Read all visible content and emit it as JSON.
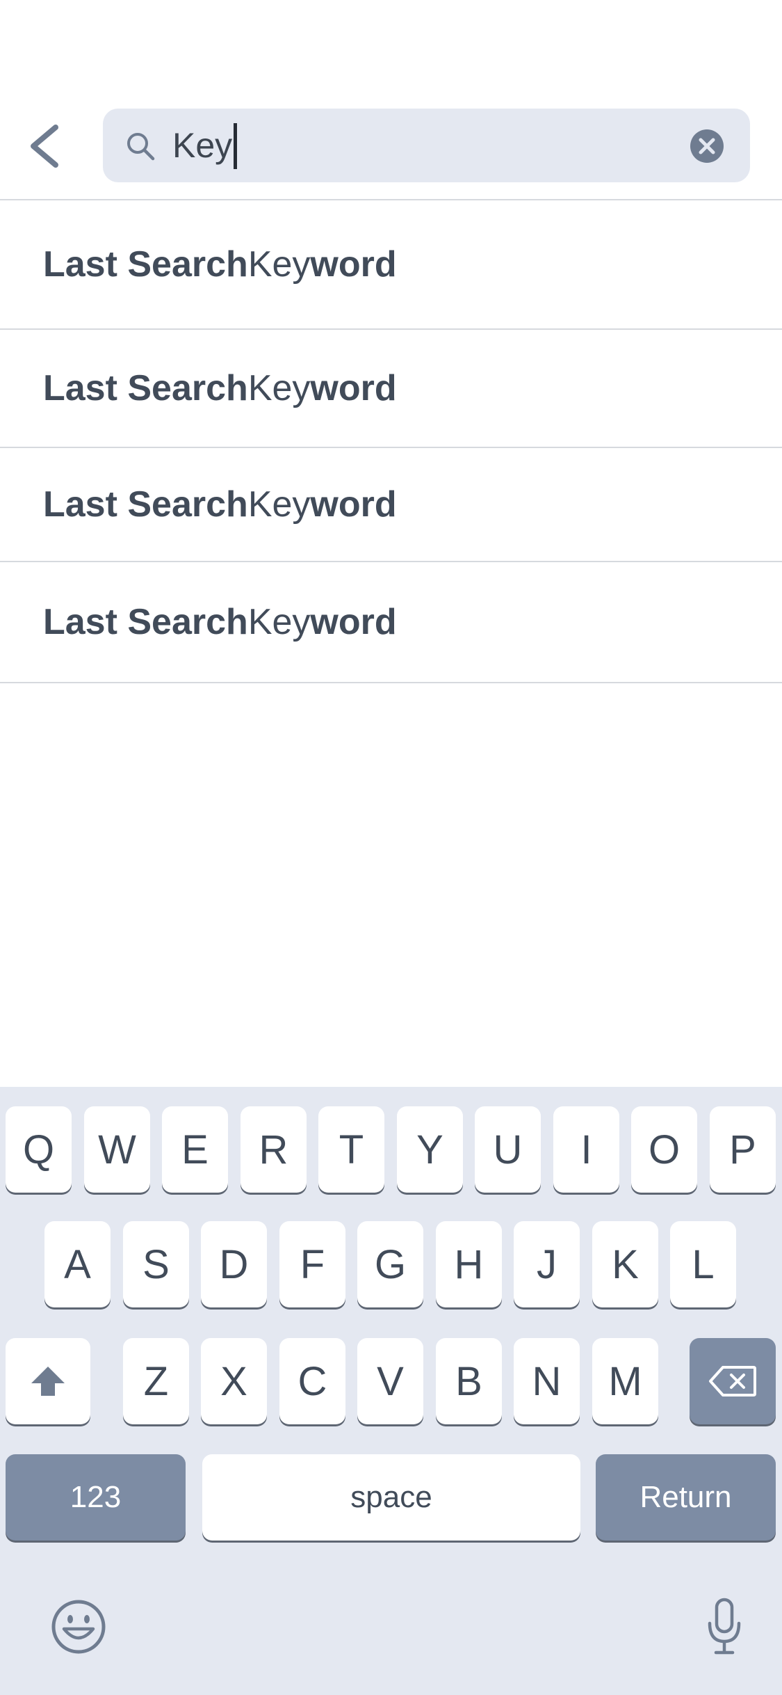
{
  "search": {
    "value": "Key"
  },
  "suggestions": [
    {
      "prefix": "Last Search",
      "match": "Key",
      "suffix": "word"
    },
    {
      "prefix": "Last Search",
      "match": "Key",
      "suffix": "word"
    },
    {
      "prefix": "Last Search",
      "match": "Key",
      "suffix": "word"
    },
    {
      "prefix": "Last Search",
      "match": "Key",
      "suffix": "word"
    }
  ],
  "keyboard": {
    "row1": [
      "Q",
      "W",
      "E",
      "R",
      "T",
      "Y",
      "U",
      "I",
      "O",
      "P"
    ],
    "row2": [
      "A",
      "S",
      "D",
      "F",
      "G",
      "H",
      "J",
      "K",
      "L"
    ],
    "row3": [
      "Z",
      "X",
      "C",
      "V",
      "B",
      "N",
      "M"
    ],
    "numbers_label": "123",
    "space_label": "space",
    "return_label": "Return"
  },
  "icons": {
    "back": "chevron-left-icon",
    "search": "search-icon",
    "clear": "clear-circle-icon",
    "shift": "shift-icon",
    "backspace": "backspace-icon",
    "emoji": "emoji-icon",
    "mic": "microphone-icon"
  },
  "colors": {
    "text": "#414b59",
    "search_bg": "#e4e8f1",
    "keyboard_bg": "#e4e8f1",
    "dark_key": "#7d8ca4",
    "icon": "#6f7c90"
  }
}
